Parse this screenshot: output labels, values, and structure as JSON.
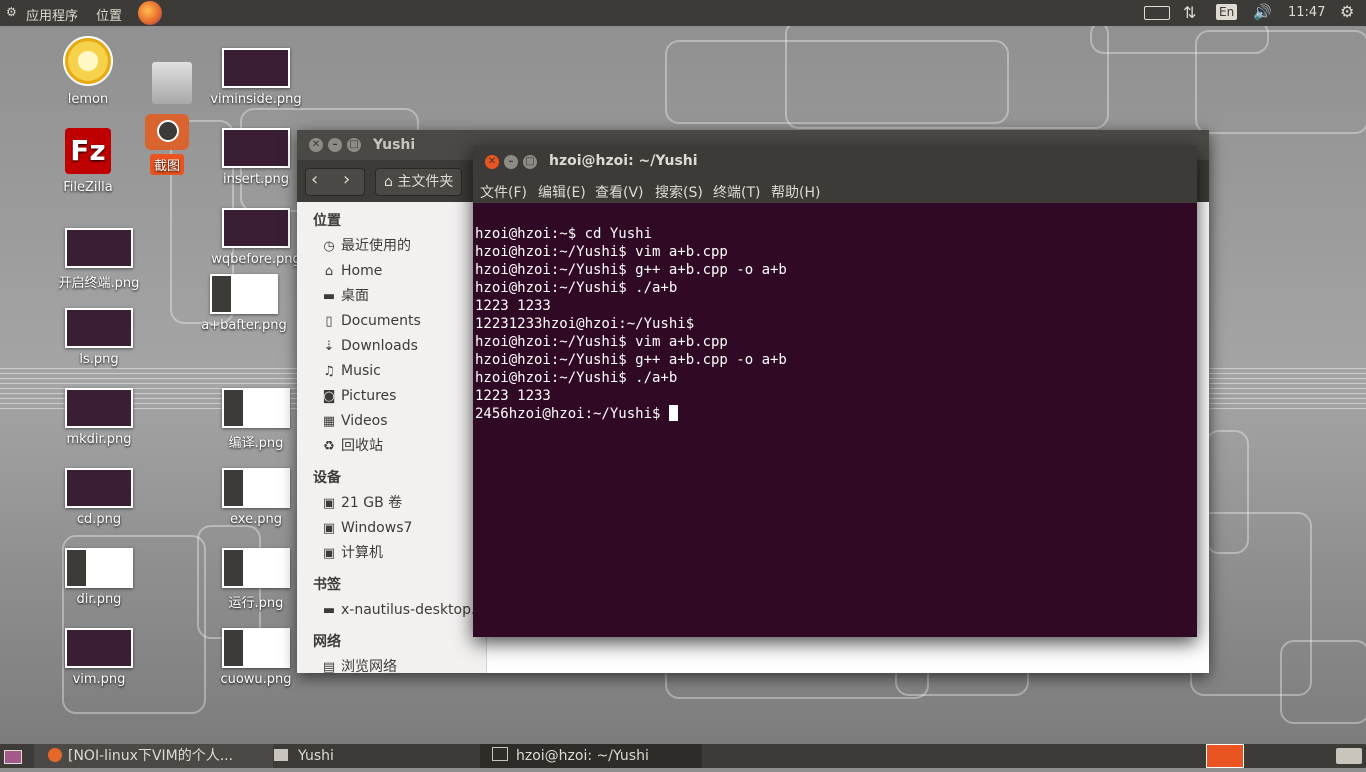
{
  "top_panel": {
    "applications": "应用程序",
    "places": "位置",
    "clock": "11:47",
    "keyboard_layout": "En",
    "icons": [
      "keyboard-icon",
      "network-icon",
      "volume-icon",
      "settings-gear-icon"
    ]
  },
  "desktop_icons": [
    {
      "name": "lemon",
      "label": "lemon",
      "kind": "lemon-app-icon"
    },
    {
      "name": "viminside",
      "label": "viminside.png",
      "kind": "image-thumbnail"
    },
    {
      "name": "filezilla",
      "label": "FileZilla",
      "kind": "filezilla-icon"
    },
    {
      "name": "screenshot",
      "label": "截图",
      "kind": "screenshot-camera-icon"
    },
    {
      "name": "insert",
      "label": "insert.png",
      "kind": "image-thumbnail"
    },
    {
      "name": "wqbefore",
      "label": "wqbefore.png",
      "kind": "image-thumbnail"
    },
    {
      "name": "open-terminal",
      "label": "开启终端.png",
      "kind": "image-thumbnail"
    },
    {
      "name": "abafter",
      "label": "a+bafter.png",
      "kind": "image-thumbnail"
    },
    {
      "name": "ls",
      "label": "ls.png",
      "kind": "image-thumbnail"
    },
    {
      "name": "mkdir",
      "label": "mkdir.png",
      "kind": "image-thumbnail"
    },
    {
      "name": "compile",
      "label": "编译.png",
      "kind": "image-thumbnail"
    },
    {
      "name": "cd",
      "label": "cd.png",
      "kind": "image-thumbnail"
    },
    {
      "name": "exe",
      "label": "exe.png",
      "kind": "image-thumbnail"
    },
    {
      "name": "dir",
      "label": "dir.png",
      "kind": "image-thumbnail"
    },
    {
      "name": "run",
      "label": "运行.png",
      "kind": "image-thumbnail"
    },
    {
      "name": "vim",
      "label": "vim.png",
      "kind": "image-thumbnail"
    },
    {
      "name": "cuowu",
      "label": "cuowu.png",
      "kind": "image-thumbnail"
    }
  ],
  "file_manager": {
    "title": "Yushi",
    "path_button": "主文件夹",
    "sections": [
      {
        "heading": "位置",
        "items": [
          {
            "label": "最近使用的",
            "icon": "clock-icon"
          },
          {
            "label": "Home",
            "icon": "home-icon"
          },
          {
            "label": "桌面",
            "icon": "folder-icon"
          },
          {
            "label": "Documents",
            "icon": "document-icon"
          },
          {
            "label": "Downloads",
            "icon": "download-icon"
          },
          {
            "label": "Music",
            "icon": "music-icon"
          },
          {
            "label": "Pictures",
            "icon": "camera-icon"
          },
          {
            "label": "Videos",
            "icon": "film-icon"
          },
          {
            "label": "回收站",
            "icon": "trash-icon"
          }
        ]
      },
      {
        "heading": "设备",
        "items": [
          {
            "label": "21 GB 卷",
            "icon": "drive-icon"
          },
          {
            "label": "Windows7",
            "icon": "drive-icon"
          },
          {
            "label": "计算机",
            "icon": "drive-icon"
          }
        ]
      },
      {
        "heading": "书签",
        "items": [
          {
            "label": "x-nautilus-desktop...",
            "icon": "network-folder-icon"
          }
        ]
      },
      {
        "heading": "网络",
        "items": [
          {
            "label": "浏览网络",
            "icon": "network-icon"
          }
        ]
      }
    ]
  },
  "terminal": {
    "title": "hzoi@hzoi: ~/Yushi",
    "menu": [
      "文件(F)",
      "编辑(E)",
      "查看(V)",
      "搜索(S)",
      "终端(T)",
      "帮助(H)"
    ],
    "lines": [
      "hzoi@hzoi:~$ cd Yushi",
      "hzoi@hzoi:~/Yushi$ vim a+b.cpp",
      "hzoi@hzoi:~/Yushi$ g++ a+b.cpp -o a+b",
      "hzoi@hzoi:~/Yushi$ ./a+b",
      "1223 1233",
      "12231233hzoi@hzoi:~/Yushi$",
      "hzoi@hzoi:~/Yushi$ vim a+b.cpp",
      "hzoi@hzoi:~/Yushi$ g++ a+b.cpp -o a+b",
      "hzoi@hzoi:~/Yushi$ ./a+b",
      "1223 1233",
      "2456hzoi@hzoi:~/Yushi$ "
    ]
  },
  "taskbar": {
    "items": [
      {
        "label": "[NOI-linux下VIM的个人...",
        "icon": "firefox-icon"
      },
      {
        "label": "Yushi",
        "icon": "file-manager-icon"
      },
      {
        "label": "hzoi@hzoi: ~/Yushi",
        "icon": "terminal-icon"
      }
    ]
  },
  "colors": {
    "panel": "#3c3b37",
    "terminal_bg": "#300a24",
    "close_button": "#e95420"
  }
}
